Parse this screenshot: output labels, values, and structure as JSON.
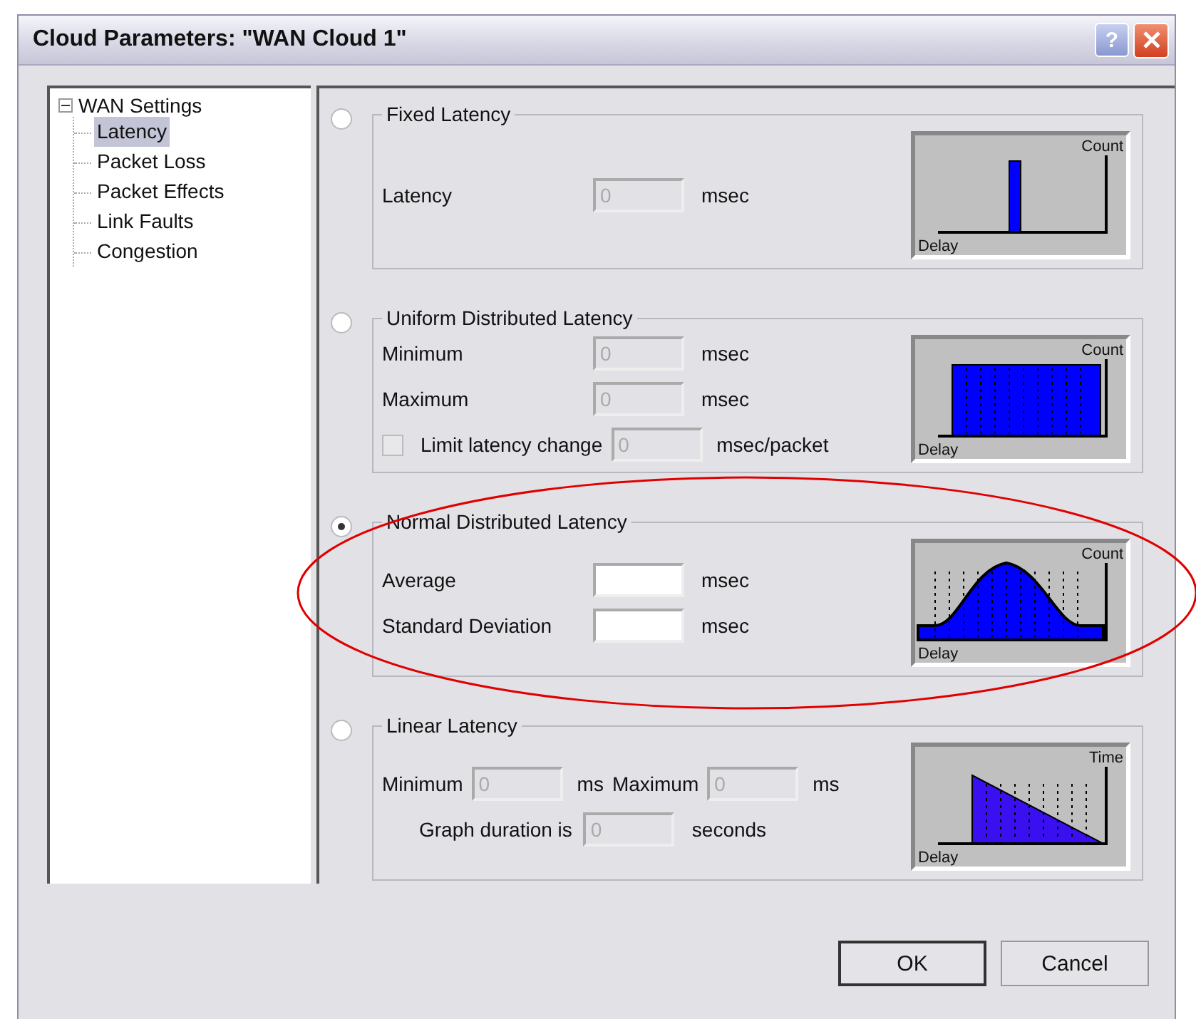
{
  "window": {
    "title": "Cloud Parameters: \"WAN Cloud 1\"",
    "help": "?"
  },
  "tree": {
    "label": "WAN Settings",
    "expanded": true,
    "children": [
      {
        "label": "Latency",
        "selected": true
      },
      {
        "label": "Packet Loss",
        "selected": false
      },
      {
        "label": "Packet Effects",
        "selected": false
      },
      {
        "label": "Link Faults",
        "selected": false
      },
      {
        "label": "Congestion",
        "selected": false
      }
    ]
  },
  "sections": [
    {
      "title": "Fixed Latency",
      "selected": false,
      "graph": {
        "kind": "spike",
        "y_label": "Count",
        "x_label": "Delay"
      },
      "rows": [
        {
          "kind": "labeled",
          "items": [
            {
              "kind": "label",
              "text": "Latency"
            },
            {
              "kind": "field",
              "value": "0",
              "disabled": true
            },
            {
              "kind": "unit",
              "text": "msec"
            }
          ]
        }
      ]
    },
    {
      "title": "Uniform Distributed Latency",
      "selected": false,
      "graph": {
        "kind": "uniform",
        "y_label": "Count",
        "x_label": "Delay"
      },
      "rows": [
        {
          "kind": "labeled",
          "items": [
            {
              "kind": "label",
              "text": "Minimum"
            },
            {
              "kind": "field",
              "value": "0",
              "disabled": true
            },
            {
              "kind": "unit",
              "text": "msec"
            }
          ]
        },
        {
          "kind": "labeled",
          "items": [
            {
              "kind": "label",
              "text": "Maximum"
            },
            {
              "kind": "field",
              "value": "0",
              "disabled": true
            },
            {
              "kind": "unit",
              "text": "msec"
            }
          ]
        },
        {
          "kind": "inline",
          "items": [
            {
              "kind": "checkbox",
              "text": "Limit latency change",
              "checked": false,
              "disabled": true
            },
            {
              "kind": "field",
              "value": "0",
              "disabled": true
            },
            {
              "kind": "unit",
              "text": "msec/packet"
            }
          ]
        }
      ]
    },
    {
      "title": "Normal Distributed Latency",
      "selected": true,
      "highlighted": true,
      "graph": {
        "kind": "normal",
        "y_label": "Count",
        "x_label": "Delay"
      },
      "rows": [
        {
          "kind": "labeled",
          "items": [
            {
              "kind": "label",
              "text": "Average"
            },
            {
              "kind": "field",
              "disabled": false
            },
            {
              "kind": "unit",
              "text": "msec"
            }
          ]
        },
        {
          "kind": "labeled",
          "items": [
            {
              "kind": "label",
              "text": "Standard Deviation"
            },
            {
              "kind": "field",
              "disabled": false
            },
            {
              "kind": "unit",
              "text": "msec"
            }
          ]
        }
      ]
    },
    {
      "title": "Linear Latency",
      "selected": false,
      "graph": {
        "kind": "linear",
        "y_label": "Time",
        "x_label": "Delay"
      },
      "rows": [
        {
          "kind": "inline",
          "items": [
            {
              "kind": "label",
              "text": "Minimum"
            },
            {
              "kind": "field",
              "value": "0",
              "disabled": true
            },
            {
              "kind": "unit",
              "text": "ms"
            },
            {
              "kind": "label",
              "text": "Maximum"
            },
            {
              "kind": "field",
              "value": "0",
              "disabled": true
            },
            {
              "kind": "unit",
              "text": "ms"
            }
          ]
        },
        {
          "kind": "indented",
          "items": [
            {
              "kind": "label",
              "text": "Graph duration is"
            },
            {
              "kind": "field",
              "value": "0",
              "disabled": true
            },
            {
              "kind": "unit",
              "text": "seconds"
            }
          ]
        }
      ]
    }
  ],
  "buttons": [
    {
      "label": "OK",
      "default": true
    },
    {
      "label": "Cancel",
      "default": false
    }
  ]
}
